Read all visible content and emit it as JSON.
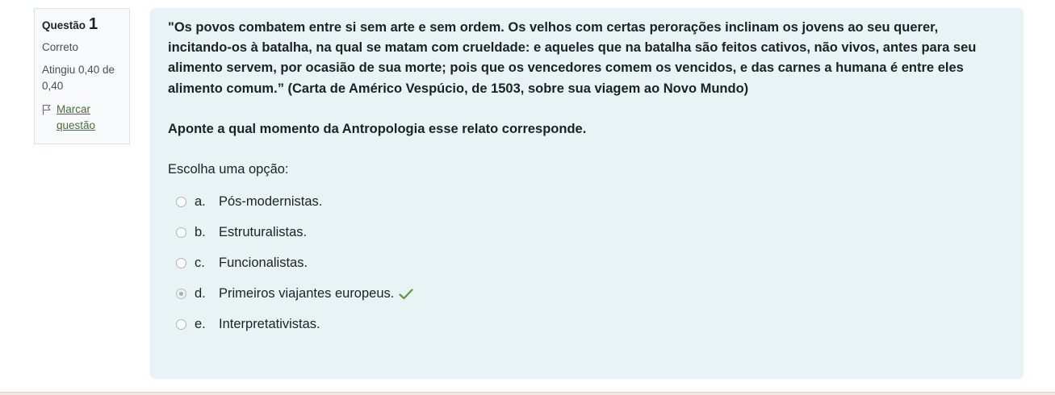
{
  "info": {
    "question_label": "Questão",
    "question_number": "1",
    "state": "Correto",
    "grade": "Atingiu 0,40 de 0,40",
    "flag_label": "Marcar questão"
  },
  "question": {
    "text": "\"Os povos combatem entre si sem arte e sem ordem. Os velhos com certas perorações inclinam os jovens ao seu querer, incitando-os à batalha, na qual se matam com crueldade: e aqueles que na batalha são feitos cativos, não vivos, antes para seu alimento servem, por ocasião de sua morte; pois que os vencedores comem os vencidos, e das carnes a humana é entre eles alimento comum.” (Carta de Américo Vespúcio, de 1503, sobre sua viagem ao Novo Mundo)",
    "prompt": "Aponte a qual momento da Antropologia esse relato corresponde.",
    "choose_label": "Escolha uma opção:",
    "answers": [
      {
        "letter": "a.",
        "text": "Pós-modernistas."
      },
      {
        "letter": "b.",
        "text": "Estruturalistas."
      },
      {
        "letter": "c.",
        "text": "Funcionalistas."
      },
      {
        "letter": "d.",
        "text": "Primeiros viajantes europeus."
      },
      {
        "letter": "e.",
        "text": "Interpretativistas."
      }
    ],
    "selected_index": 3
  },
  "icons": {
    "flag": "flag-icon",
    "correct": "check-icon"
  },
  "colors": {
    "content_bg": "#e7f3f5",
    "info_bg": "#f8f9fa",
    "link": "#4a6e3a",
    "correct": "#5a9a3c"
  }
}
